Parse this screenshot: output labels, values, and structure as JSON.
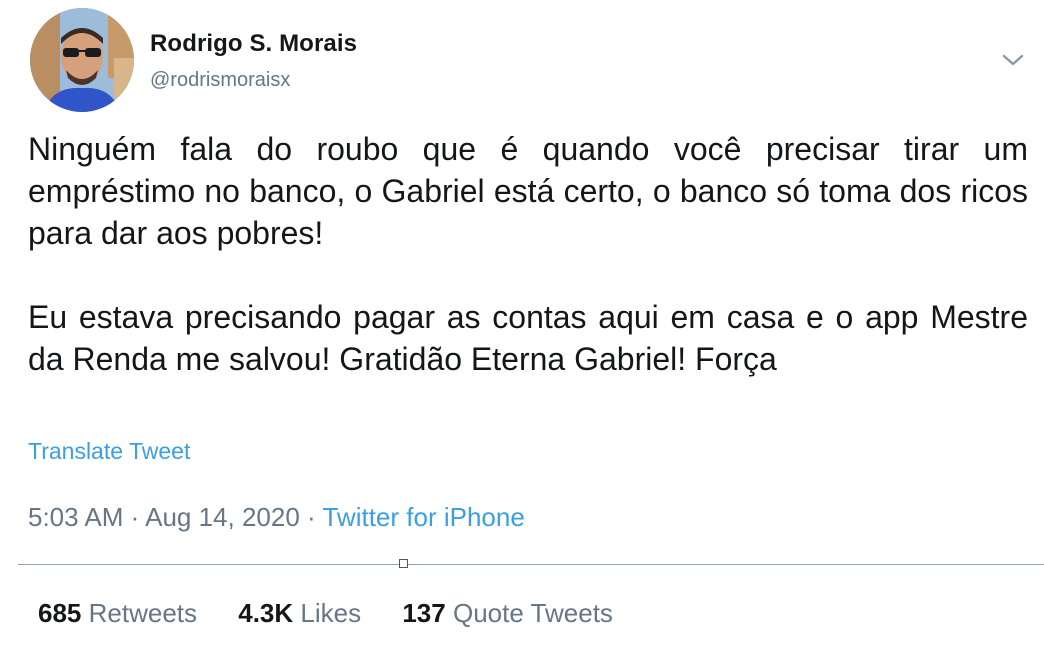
{
  "author": {
    "name": "Rodrigo S. Morais",
    "handle": "@rodrismoraisx"
  },
  "tweet": {
    "paragraphs": [
      "Ninguém fala do roubo que é quando você precisar tirar um empréstimo no banco, o Gabriel está certo, o banco só toma dos ricos para dar aos pobres!",
      "Eu estava precisando pagar as contas aqui em casa e o app Mestre da Renda me salvou! Gratidão Eterna Gabriel! Força"
    ],
    "translate_label": "Translate Tweet",
    "time": "5:03 AM",
    "separator": "·",
    "date": "Aug 14, 2020",
    "source": "Twitter for iPhone"
  },
  "stats": {
    "retweets": {
      "count": "685",
      "label": "Retweets"
    },
    "likes": {
      "count": "4.3K",
      "label": "Likes"
    },
    "quotes": {
      "count": "137",
      "label": "Quote Tweets"
    }
  },
  "colors": {
    "link": "#3b9fe4",
    "secondary_text": "#657786",
    "primary_text": "#14171a"
  },
  "icons": {
    "menu": "chevron-down-icon",
    "avatar": "avatar"
  }
}
